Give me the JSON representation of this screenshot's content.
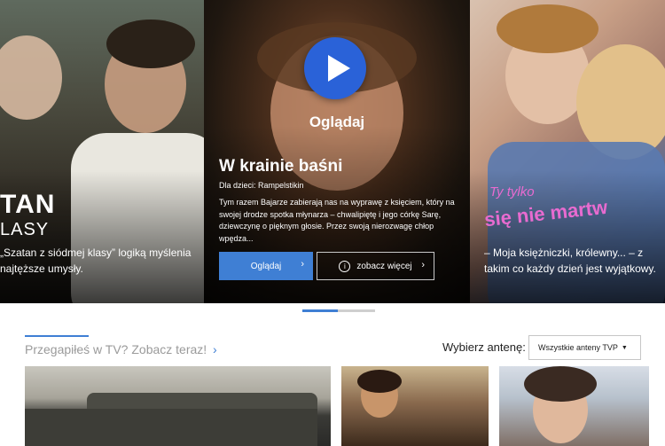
{
  "carousel": {
    "left": {
      "title_part1": "TAN",
      "title_part2": "LASY",
      "caption": "„Szatan z siódmej klasy” logiką myślenia najtęższe umysły."
    },
    "center": {
      "play_label": "Oglądaj",
      "title": "W krainie baśni",
      "subtitle": "Dla dzieci: Rampelstikin",
      "description": "Tym razem Bajarze zabierają nas na wyprawę z księciem, który na swojej drodze spotka młynarza – chwalipiętę i jego córkę Sarę, dziewczynę o pięknym głosie. Przez swoją nierozwagę chłop wpędza...",
      "watch_button": "Oglądaj",
      "more_button": "zobacz więcej"
    },
    "right": {
      "logo_line1": "Ty tylko",
      "logo_line2": "się nie martw",
      "caption": "– Moja księżniczki, królewny... – z takim co każdy dzień jest wyjątkowy."
    },
    "pager": {
      "active_index": 0,
      "count": 2
    }
  },
  "section": {
    "title": "Przegapiłeś w TV? Zobacz teraz!",
    "antenna_label": "Wybierz antenę:",
    "antenna_selected": "Wszystkie anteny TVP"
  },
  "colors": {
    "accent": "#3f7fd4",
    "play": "#2a62d8",
    "right_logo": "#e86bd0"
  },
  "icons": [
    "play-icon",
    "chevron-right-icon",
    "info-icon",
    "caret-down-icon"
  ]
}
